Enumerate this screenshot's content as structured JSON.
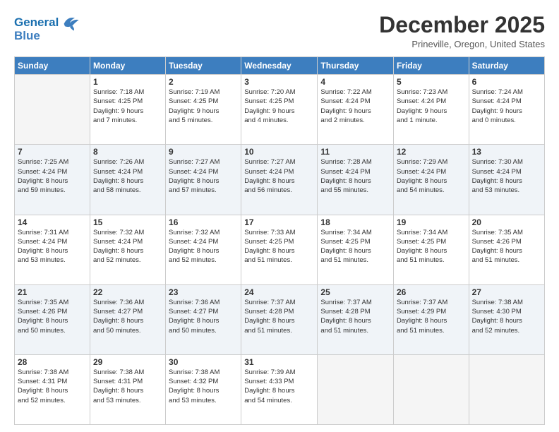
{
  "logo": {
    "line1": "General",
    "line2": "Blue"
  },
  "title": "December 2025",
  "location": "Prineville, Oregon, United States",
  "weekdays": [
    "Sunday",
    "Monday",
    "Tuesday",
    "Wednesday",
    "Thursday",
    "Friday",
    "Saturday"
  ],
  "weeks": [
    [
      {
        "day": "",
        "info": ""
      },
      {
        "day": "1",
        "info": "Sunrise: 7:18 AM\nSunset: 4:25 PM\nDaylight: 9 hours\nand 7 minutes."
      },
      {
        "day": "2",
        "info": "Sunrise: 7:19 AM\nSunset: 4:25 PM\nDaylight: 9 hours\nand 5 minutes."
      },
      {
        "day": "3",
        "info": "Sunrise: 7:20 AM\nSunset: 4:25 PM\nDaylight: 9 hours\nand 4 minutes."
      },
      {
        "day": "4",
        "info": "Sunrise: 7:22 AM\nSunset: 4:24 PM\nDaylight: 9 hours\nand 2 minutes."
      },
      {
        "day": "5",
        "info": "Sunrise: 7:23 AM\nSunset: 4:24 PM\nDaylight: 9 hours\nand 1 minute."
      },
      {
        "day": "6",
        "info": "Sunrise: 7:24 AM\nSunset: 4:24 PM\nDaylight: 9 hours\nand 0 minutes."
      }
    ],
    [
      {
        "day": "7",
        "info": "Sunrise: 7:25 AM\nSunset: 4:24 PM\nDaylight: 8 hours\nand 59 minutes."
      },
      {
        "day": "8",
        "info": "Sunrise: 7:26 AM\nSunset: 4:24 PM\nDaylight: 8 hours\nand 58 minutes."
      },
      {
        "day": "9",
        "info": "Sunrise: 7:27 AM\nSunset: 4:24 PM\nDaylight: 8 hours\nand 57 minutes."
      },
      {
        "day": "10",
        "info": "Sunrise: 7:27 AM\nSunset: 4:24 PM\nDaylight: 8 hours\nand 56 minutes."
      },
      {
        "day": "11",
        "info": "Sunrise: 7:28 AM\nSunset: 4:24 PM\nDaylight: 8 hours\nand 55 minutes."
      },
      {
        "day": "12",
        "info": "Sunrise: 7:29 AM\nSunset: 4:24 PM\nDaylight: 8 hours\nand 54 minutes."
      },
      {
        "day": "13",
        "info": "Sunrise: 7:30 AM\nSunset: 4:24 PM\nDaylight: 8 hours\nand 53 minutes."
      }
    ],
    [
      {
        "day": "14",
        "info": "Sunrise: 7:31 AM\nSunset: 4:24 PM\nDaylight: 8 hours\nand 53 minutes."
      },
      {
        "day": "15",
        "info": "Sunrise: 7:32 AM\nSunset: 4:24 PM\nDaylight: 8 hours\nand 52 minutes."
      },
      {
        "day": "16",
        "info": "Sunrise: 7:32 AM\nSunset: 4:24 PM\nDaylight: 8 hours\nand 52 minutes."
      },
      {
        "day": "17",
        "info": "Sunrise: 7:33 AM\nSunset: 4:25 PM\nDaylight: 8 hours\nand 51 minutes."
      },
      {
        "day": "18",
        "info": "Sunrise: 7:34 AM\nSunset: 4:25 PM\nDaylight: 8 hours\nand 51 minutes."
      },
      {
        "day": "19",
        "info": "Sunrise: 7:34 AM\nSunset: 4:25 PM\nDaylight: 8 hours\nand 51 minutes."
      },
      {
        "day": "20",
        "info": "Sunrise: 7:35 AM\nSunset: 4:26 PM\nDaylight: 8 hours\nand 51 minutes."
      }
    ],
    [
      {
        "day": "21",
        "info": "Sunrise: 7:35 AM\nSunset: 4:26 PM\nDaylight: 8 hours\nand 50 minutes."
      },
      {
        "day": "22",
        "info": "Sunrise: 7:36 AM\nSunset: 4:27 PM\nDaylight: 8 hours\nand 50 minutes."
      },
      {
        "day": "23",
        "info": "Sunrise: 7:36 AM\nSunset: 4:27 PM\nDaylight: 8 hours\nand 50 minutes."
      },
      {
        "day": "24",
        "info": "Sunrise: 7:37 AM\nSunset: 4:28 PM\nDaylight: 8 hours\nand 51 minutes."
      },
      {
        "day": "25",
        "info": "Sunrise: 7:37 AM\nSunset: 4:28 PM\nDaylight: 8 hours\nand 51 minutes."
      },
      {
        "day": "26",
        "info": "Sunrise: 7:37 AM\nSunset: 4:29 PM\nDaylight: 8 hours\nand 51 minutes."
      },
      {
        "day": "27",
        "info": "Sunrise: 7:38 AM\nSunset: 4:30 PM\nDaylight: 8 hours\nand 52 minutes."
      }
    ],
    [
      {
        "day": "28",
        "info": "Sunrise: 7:38 AM\nSunset: 4:31 PM\nDaylight: 8 hours\nand 52 minutes."
      },
      {
        "day": "29",
        "info": "Sunrise: 7:38 AM\nSunset: 4:31 PM\nDaylight: 8 hours\nand 53 minutes."
      },
      {
        "day": "30",
        "info": "Sunrise: 7:38 AM\nSunset: 4:32 PM\nDaylight: 8 hours\nand 53 minutes."
      },
      {
        "day": "31",
        "info": "Sunrise: 7:39 AM\nSunset: 4:33 PM\nDaylight: 8 hours\nand 54 minutes."
      },
      {
        "day": "",
        "info": ""
      },
      {
        "day": "",
        "info": ""
      },
      {
        "day": "",
        "info": ""
      }
    ]
  ]
}
